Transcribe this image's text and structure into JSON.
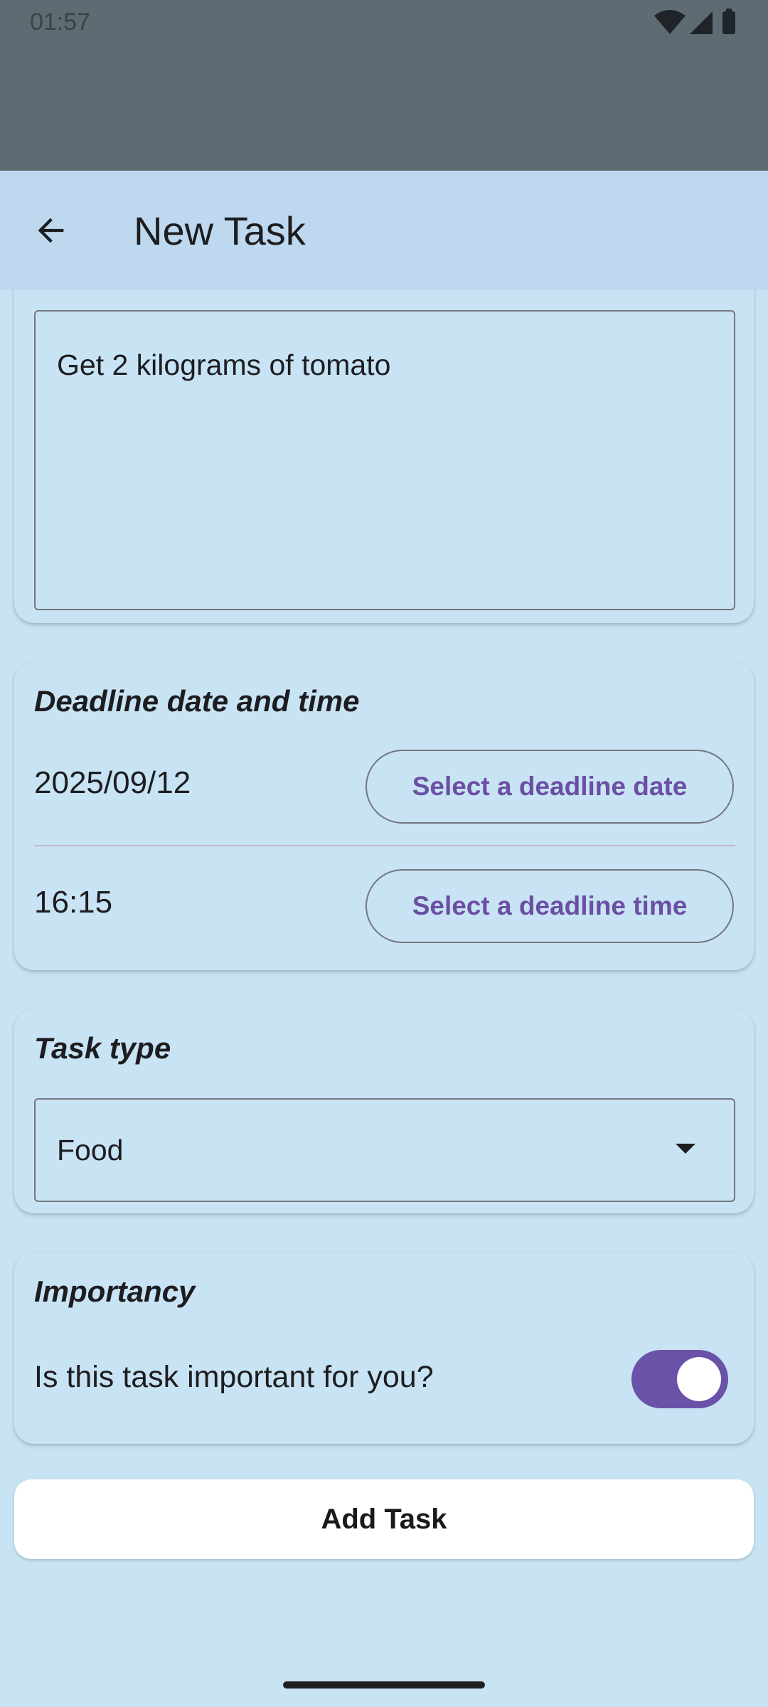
{
  "status_bar": {
    "time": "01:57"
  },
  "appbar": {
    "title": "New Task"
  },
  "description": {
    "value": "Get 2 kilograms of tomato"
  },
  "deadline": {
    "title": "Deadline date and time",
    "date_value": "2025/09/12",
    "date_button": "Select a deadline date",
    "time_value": "16:15",
    "time_button": "Select a deadline time"
  },
  "task_type": {
    "title": "Task type",
    "selected": "Food"
  },
  "importancy": {
    "title": "Importancy",
    "question": "Is this task important for you?",
    "enabled": true
  },
  "add_button": "Add Task",
  "colors": {
    "accent": "#6a52a8",
    "button_text": "#6a4fa3",
    "background": "#c8e3f4",
    "appbar": "#bed9ef"
  }
}
